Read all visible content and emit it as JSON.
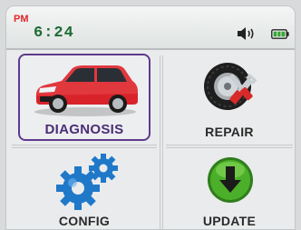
{
  "status": {
    "ampm": "PM",
    "time": "6:24",
    "icons": [
      "volume-icon",
      "battery-icon"
    ],
    "colors": {
      "ampm": "#e0262b",
      "time": "#1d6b34",
      "battery": "#3aa33a"
    }
  },
  "menu": {
    "selected": "DIAGNOSIS",
    "items": [
      {
        "label": "DIAGNOSIS",
        "icon": "car-icon",
        "selected": true
      },
      {
        "label": "REPAIR",
        "icon": "wheel-wrench-icon",
        "selected": false
      },
      {
        "label": "CONFIG",
        "icon": "gears-icon",
        "selected": false
      },
      {
        "label": "UPDATE",
        "icon": "download-arrow-icon",
        "selected": false
      }
    ],
    "colors": {
      "selection_border": "#5e3a8d",
      "update_green": "#4caf2a",
      "gear_blue": "#1f78c8"
    }
  }
}
